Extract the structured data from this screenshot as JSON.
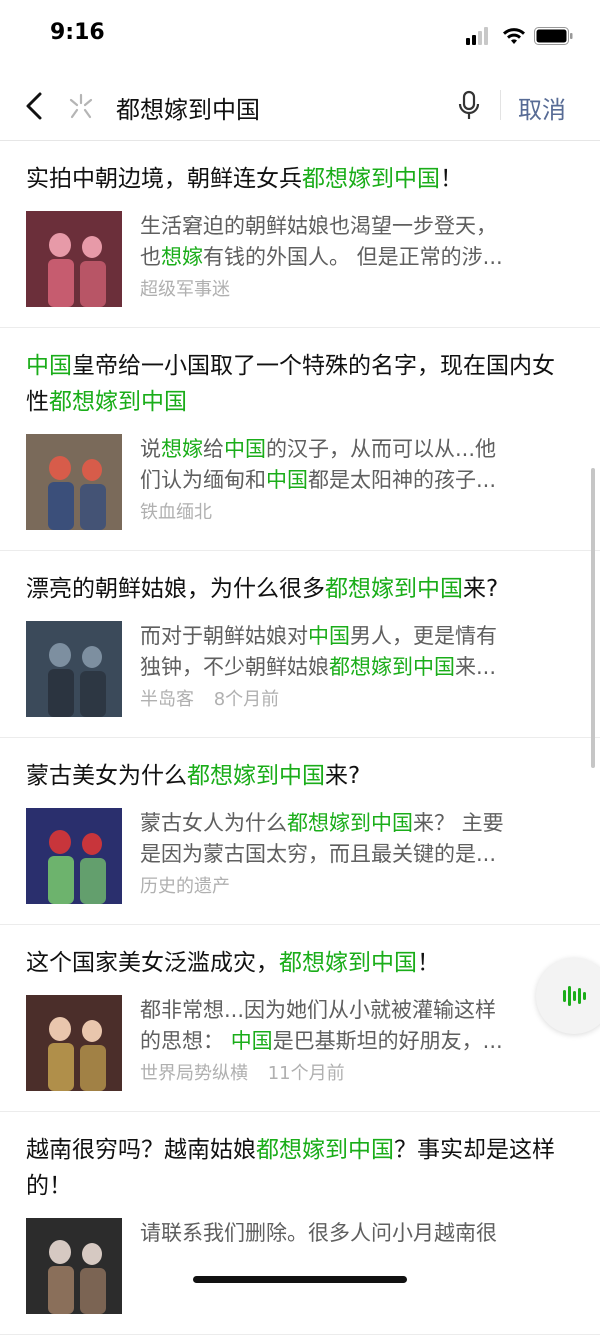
{
  "status_bar": {
    "time": "9:16"
  },
  "search": {
    "query": "都想嫁到中国",
    "cancel_label": "取消"
  },
  "results": [
    {
      "title": [
        [
          "实拍中朝边境，朝鲜连女兵",
          0
        ],
        [
          "都想嫁到中国",
          1
        ],
        [
          "！",
          0
        ]
      ],
      "snippet_line1": [
        [
          "生活窘迫的朝鲜姑娘也渴望一步登天，",
          0
        ]
      ],
      "snippet_line2": [
        [
          "也",
          0
        ],
        [
          "想嫁",
          1
        ],
        [
          "有钱的外国人。 但是正常的涉...",
          0
        ]
      ],
      "source": "超级军事迷",
      "time": ""
    },
    {
      "title": [
        [
          "中国",
          1
        ],
        [
          "皇帝给一小国取了一个特殊的名字，现在国内女性",
          0
        ],
        [
          "都想嫁到中国",
          1
        ]
      ],
      "snippet_line1": [
        [
          "说",
          0
        ],
        [
          "想嫁",
          1
        ],
        [
          "给",
          0
        ],
        [
          "中国",
          1
        ],
        [
          "的汉子，从而可以从...他",
          0
        ]
      ],
      "snippet_line2": [
        [
          "们认为缅甸和",
          0
        ],
        [
          "中国",
          1
        ],
        [
          "都是太阳神的孩子...",
          0
        ]
      ],
      "source": "铁血缅北",
      "time": ""
    },
    {
      "title": [
        [
          "漂亮的朝鲜姑娘，为什么很多",
          0
        ],
        [
          "都想嫁到中国",
          1
        ],
        [
          "来?",
          0
        ]
      ],
      "snippet_line1": [
        [
          "而对于朝鲜姑娘对",
          0
        ],
        [
          "中国",
          1
        ],
        [
          "男人，更是情有",
          0
        ]
      ],
      "snippet_line2": [
        [
          "独钟，不少朝鲜姑娘",
          0
        ],
        [
          "都想嫁到中国",
          1
        ],
        [
          "来...",
          0
        ]
      ],
      "source": "半岛客",
      "time": "8个月前"
    },
    {
      "title": [
        [
          "蒙古美女为什么",
          0
        ],
        [
          "都想嫁到中国",
          1
        ],
        [
          "来?",
          0
        ]
      ],
      "snippet_line1": [
        [
          "蒙古女人为什么",
          0
        ],
        [
          "都想嫁到中国",
          1
        ],
        [
          "来？ 主要",
          0
        ]
      ],
      "snippet_line2": [
        [
          "是因为蒙古国太穷，而且最关键的是...",
          0
        ]
      ],
      "source": "历史的遗产",
      "time": ""
    },
    {
      "title": [
        [
          "这个国家美女泛滥成灾，",
          0
        ],
        [
          "都想嫁到中国",
          1
        ],
        [
          "！",
          0
        ]
      ],
      "snippet_line1": [
        [
          "都非常想...因为她们从小就被灌输这样",
          0
        ]
      ],
      "snippet_line2": [
        [
          "的思想： ",
          0
        ],
        [
          "中国",
          1
        ],
        [
          "是巴基斯坦的好朋友，...",
          0
        ]
      ],
      "source": "世界局势纵横",
      "time": "11个月前"
    },
    {
      "title": [
        [
          "越南很穷吗？越南姑娘",
          0
        ],
        [
          "都想嫁到中国",
          1
        ],
        [
          "？事实却是这样的！",
          0
        ]
      ],
      "snippet_line1": [
        [
          "请联系我们删除。很多人问小月越南很",
          0
        ]
      ],
      "snippet_line2": [],
      "source": "",
      "time": ""
    }
  ]
}
